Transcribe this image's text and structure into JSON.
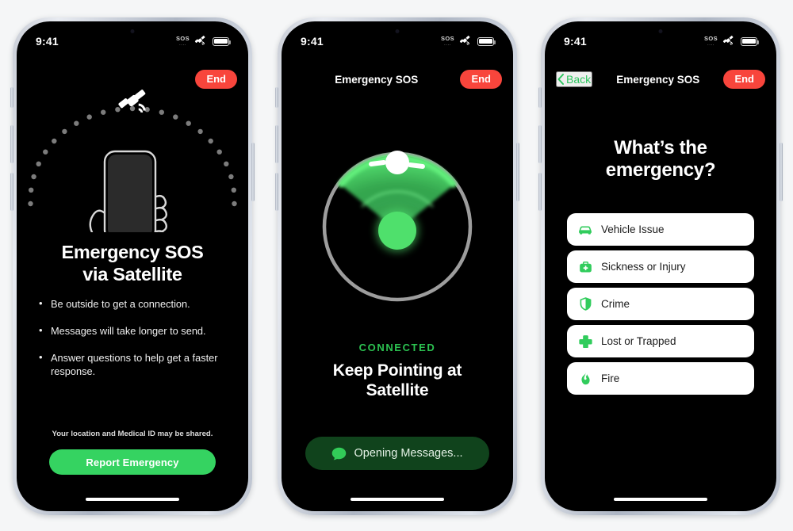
{
  "colors": {
    "accent_green": "#35d361",
    "radar_green": "#4fe06c",
    "end_red": "#f8453c",
    "back_green": "#2ec45f",
    "connected_green": "#2cc251",
    "opening_pill": "#10431c",
    "canvas": "#f5f6f7"
  },
  "status_bar": {
    "time": "9:41",
    "sos_label": "SOS",
    "sos_dots": "....",
    "satellite_icon": "satellite-icon",
    "battery_icon": "battery-icon"
  },
  "phone1": {
    "nav": {
      "title": "",
      "end_label": "End"
    },
    "art": {
      "satellite_icon": "satellite-icon",
      "hand_icon": "hand-holding-phone-icon",
      "arc_icon": "dotted-arc-icon"
    },
    "heading_line1": "Emergency SOS",
    "heading_line2": "via Satellite",
    "bullets": [
      "Be outside to get a connection.",
      "Messages will take longer to send.",
      "Answer questions to help get a faster response."
    ],
    "disclaimer": "Your location and Medical ID may be shared.",
    "primary_button": "Report Emergency"
  },
  "phone2": {
    "nav": {
      "title": "Emergency SOS",
      "end_label": "End"
    },
    "radar": {
      "satellite_icon": "satellite-icon",
      "cone_icon": "signal-cone-icon",
      "device_dot_icon": "device-dot-icon",
      "ring_icon": "radar-ring-icon"
    },
    "status": "CONNECTED",
    "title_line1": "Keep Pointing at",
    "title_line2": "Satellite",
    "action_button": {
      "label": "Opening Messages...",
      "icon": "message-bubble-icon"
    }
  },
  "phone3": {
    "nav": {
      "back_label": "Back",
      "back_icon": "chevron-left-icon",
      "title": "Emergency SOS",
      "end_label": "End"
    },
    "question_line1": "What’s the",
    "question_line2": "emergency?",
    "options": [
      {
        "label": "Vehicle Issue",
        "icon": "car-icon"
      },
      {
        "label": "Sickness or Injury",
        "icon": "medical-bag-icon"
      },
      {
        "label": "Crime",
        "icon": "shield-icon"
      },
      {
        "label": "Lost or Trapped",
        "icon": "cross-plus-icon"
      },
      {
        "label": "Fire",
        "icon": "flame-icon"
      }
    ]
  }
}
